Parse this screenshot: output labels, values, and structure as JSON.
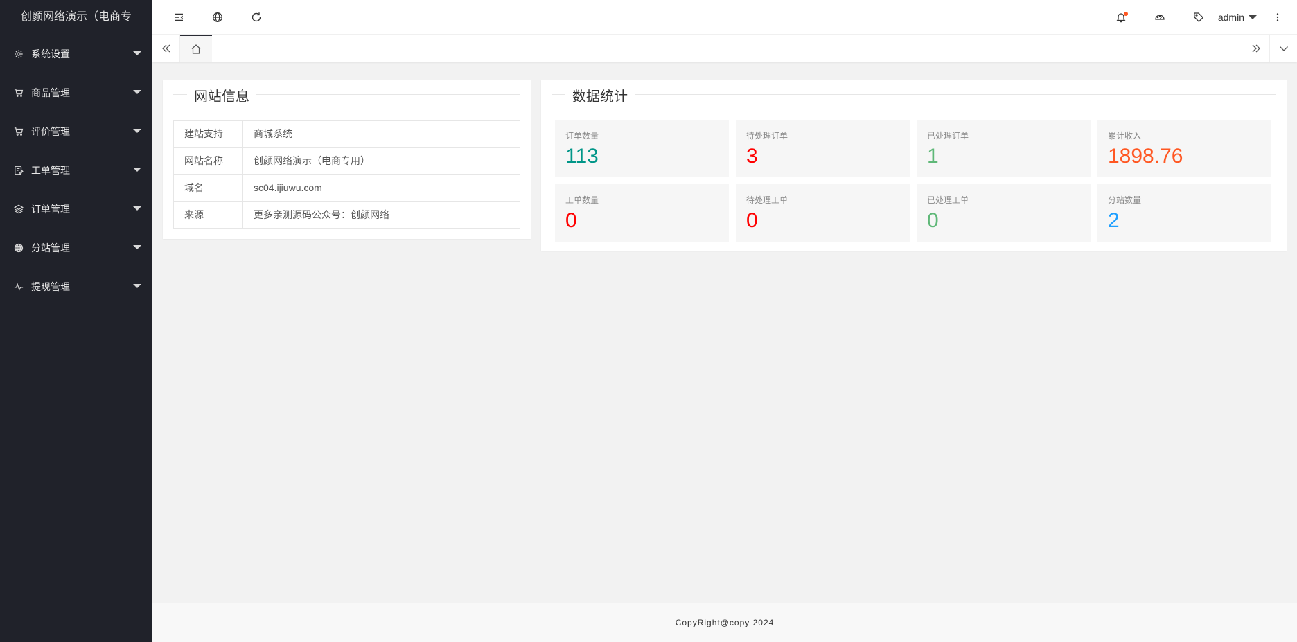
{
  "app": {
    "title": "创颜网络演示（电商专"
  },
  "sidebar": {
    "items": [
      {
        "label": "系统设置",
        "icon": "gear-icon"
      },
      {
        "label": "商品管理",
        "icon": "cart-icon"
      },
      {
        "label": "评价管理",
        "icon": "cart-icon"
      },
      {
        "label": "工单管理",
        "icon": "ticket-icon"
      },
      {
        "label": "订单管理",
        "icon": "layers-icon"
      },
      {
        "label": "分站管理",
        "icon": "globe-icon"
      },
      {
        "label": "提现管理",
        "icon": "pulse-icon"
      }
    ]
  },
  "header": {
    "user": "admin"
  },
  "info": {
    "title": "网站信息",
    "rows": [
      {
        "key": "建站支持",
        "value": "商城系统"
      },
      {
        "key": "网站名称",
        "value": "创颜网络演示（电商专用）"
      },
      {
        "key": "域名",
        "value": "sc04.ijiuwu.com"
      },
      {
        "key": "来源",
        "value": "更多亲测源码公众号：创颜网络"
      }
    ]
  },
  "stats": {
    "title": "数据统计",
    "items": [
      {
        "label": "订单数量",
        "value": "113",
        "color": "#009688"
      },
      {
        "label": "待处理订单",
        "value": "3",
        "color": "#ff0000"
      },
      {
        "label": "已处理订单",
        "value": "1",
        "color": "#5fb878"
      },
      {
        "label": "累计收入",
        "value": "1898.76",
        "color": "#ff5722"
      },
      {
        "label": "工单数量",
        "value": "0",
        "color": "#ff0000"
      },
      {
        "label": "待处理工单",
        "value": "0",
        "color": "#ff0000"
      },
      {
        "label": "已处理工单",
        "value": "0",
        "color": "#5fb878"
      },
      {
        "label": "分站数量",
        "value": "2",
        "color": "#1e9fff"
      }
    ]
  },
  "footer": {
    "text": "CopyRight@copy 2024"
  }
}
